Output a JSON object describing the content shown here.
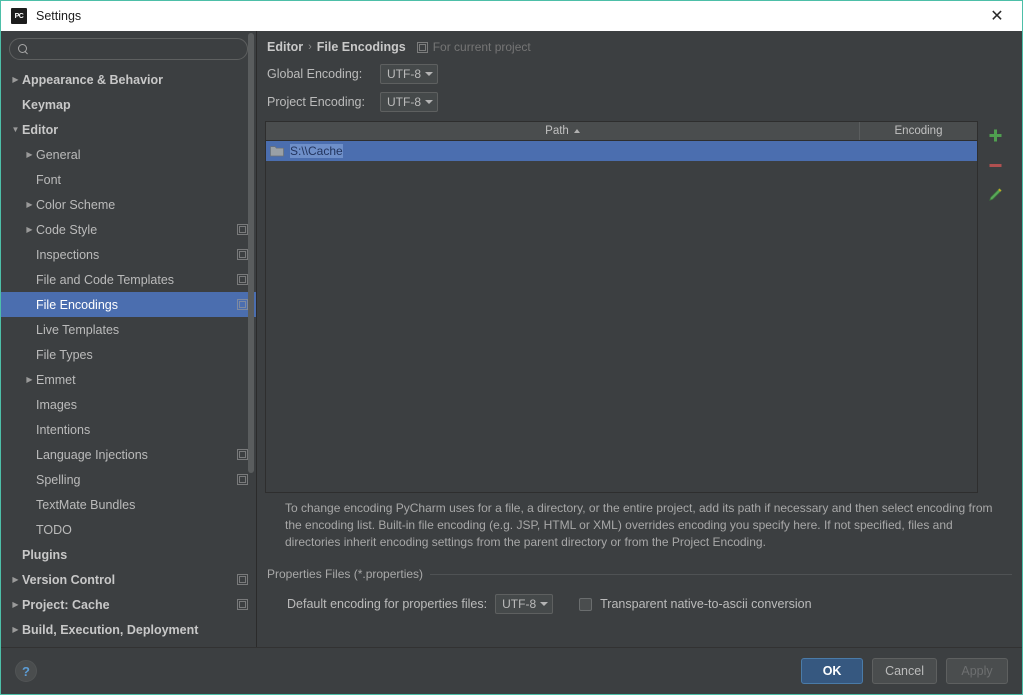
{
  "window": {
    "title": "Settings",
    "logo_text": "PC",
    "close_label": "✕",
    "accent_color": "#4dbfa8",
    "selection_color": "#4b6eaf"
  },
  "search": {
    "value": "",
    "placeholder": ""
  },
  "sidebar": {
    "items": [
      {
        "label": "Appearance & Behavior",
        "indent": 0,
        "arrow": "▶",
        "bold": true,
        "badge": false,
        "selected": false
      },
      {
        "label": "Keymap",
        "indent": 0,
        "arrow": "",
        "bold": true,
        "badge": false,
        "selected": false
      },
      {
        "label": "Editor",
        "indent": 0,
        "arrow": "▼",
        "bold": true,
        "badge": false,
        "selected": false
      },
      {
        "label": "General",
        "indent": 1,
        "arrow": "▶",
        "bold": false,
        "badge": false,
        "selected": false
      },
      {
        "label": "Font",
        "indent": 1,
        "arrow": "",
        "bold": false,
        "badge": false,
        "selected": false
      },
      {
        "label": "Color Scheme",
        "indent": 1,
        "arrow": "▶",
        "bold": false,
        "badge": false,
        "selected": false
      },
      {
        "label": "Code Style",
        "indent": 1,
        "arrow": "▶",
        "bold": false,
        "badge": true,
        "selected": false
      },
      {
        "label": "Inspections",
        "indent": 1,
        "arrow": "",
        "bold": false,
        "badge": true,
        "selected": false
      },
      {
        "label": "File and Code Templates",
        "indent": 1,
        "arrow": "",
        "bold": false,
        "badge": true,
        "selected": false
      },
      {
        "label": "File Encodings",
        "indent": 1,
        "arrow": "",
        "bold": false,
        "badge": true,
        "selected": true
      },
      {
        "label": "Live Templates",
        "indent": 1,
        "arrow": "",
        "bold": false,
        "badge": false,
        "selected": false
      },
      {
        "label": "File Types",
        "indent": 1,
        "arrow": "",
        "bold": false,
        "badge": false,
        "selected": false
      },
      {
        "label": "Emmet",
        "indent": 1,
        "arrow": "▶",
        "bold": false,
        "badge": false,
        "selected": false
      },
      {
        "label": "Images",
        "indent": 1,
        "arrow": "",
        "bold": false,
        "badge": false,
        "selected": false
      },
      {
        "label": "Intentions",
        "indent": 1,
        "arrow": "",
        "bold": false,
        "badge": false,
        "selected": false
      },
      {
        "label": "Language Injections",
        "indent": 1,
        "arrow": "",
        "bold": false,
        "badge": true,
        "selected": false
      },
      {
        "label": "Spelling",
        "indent": 1,
        "arrow": "",
        "bold": false,
        "badge": true,
        "selected": false
      },
      {
        "label": "TextMate Bundles",
        "indent": 1,
        "arrow": "",
        "bold": false,
        "badge": false,
        "selected": false
      },
      {
        "label": "TODO",
        "indent": 1,
        "arrow": "",
        "bold": false,
        "badge": false,
        "selected": false
      },
      {
        "label": "Plugins",
        "indent": 0,
        "arrow": "",
        "bold": true,
        "badge": false,
        "selected": false
      },
      {
        "label": "Version Control",
        "indent": 0,
        "arrow": "▶",
        "bold": true,
        "badge": true,
        "selected": false
      },
      {
        "label": "Project: Cache",
        "indent": 0,
        "arrow": "▶",
        "bold": true,
        "badge": true,
        "selected": false
      },
      {
        "label": "Build, Execution, Deployment",
        "indent": 0,
        "arrow": "▶",
        "bold": true,
        "badge": false,
        "selected": false
      }
    ]
  },
  "main": {
    "breadcrumb": {
      "parent": "Editor",
      "separator": "›",
      "current": "File Encodings",
      "scope_text": "For current project"
    },
    "global_encoding": {
      "label": "Global Encoding:",
      "value": "UTF-8"
    },
    "project_encoding": {
      "label": "Project Encoding:",
      "value": "UTF-8"
    },
    "table": {
      "columns": [
        {
          "key": "path",
          "label": "Path",
          "sort": "asc",
          "sort_glyph": "▲"
        },
        {
          "key": "encoding",
          "label": "Encoding",
          "sort": "",
          "sort_glyph": ""
        }
      ],
      "rows": [
        {
          "path": "S:\\\\Cache",
          "encoding": "",
          "selected": true,
          "icon": "folder-icon"
        }
      ],
      "tools": [
        {
          "name": "add-button",
          "glyph": "+",
          "color": "#4f9f4f"
        },
        {
          "name": "remove-button",
          "glyph": "−",
          "color": "#b05050"
        },
        {
          "name": "edit-button",
          "glyph": "✎",
          "color": "#5aa85a"
        }
      ]
    },
    "description": "To change encoding PyCharm uses for a file, a directory, or the entire project, add its path if necessary and then select encoding from the encoding list. Built-in file encoding (e.g. JSP, HTML or XML) overrides encoding you specify here. If not specified, files and directories inherit encoding settings from the parent directory or from the Project Encoding.",
    "properties_section": {
      "title": "Properties Files (*.properties)",
      "default_encoding_label": "Default encoding for properties files:",
      "default_encoding_value": "UTF-8",
      "checkbox_label": "Transparent native-to-ascii conversion",
      "checkbox_checked": false
    }
  },
  "footer": {
    "help_glyph": "?",
    "ok_label": "OK",
    "cancel_label": "Cancel",
    "apply_label": "Apply",
    "apply_disabled": true
  }
}
